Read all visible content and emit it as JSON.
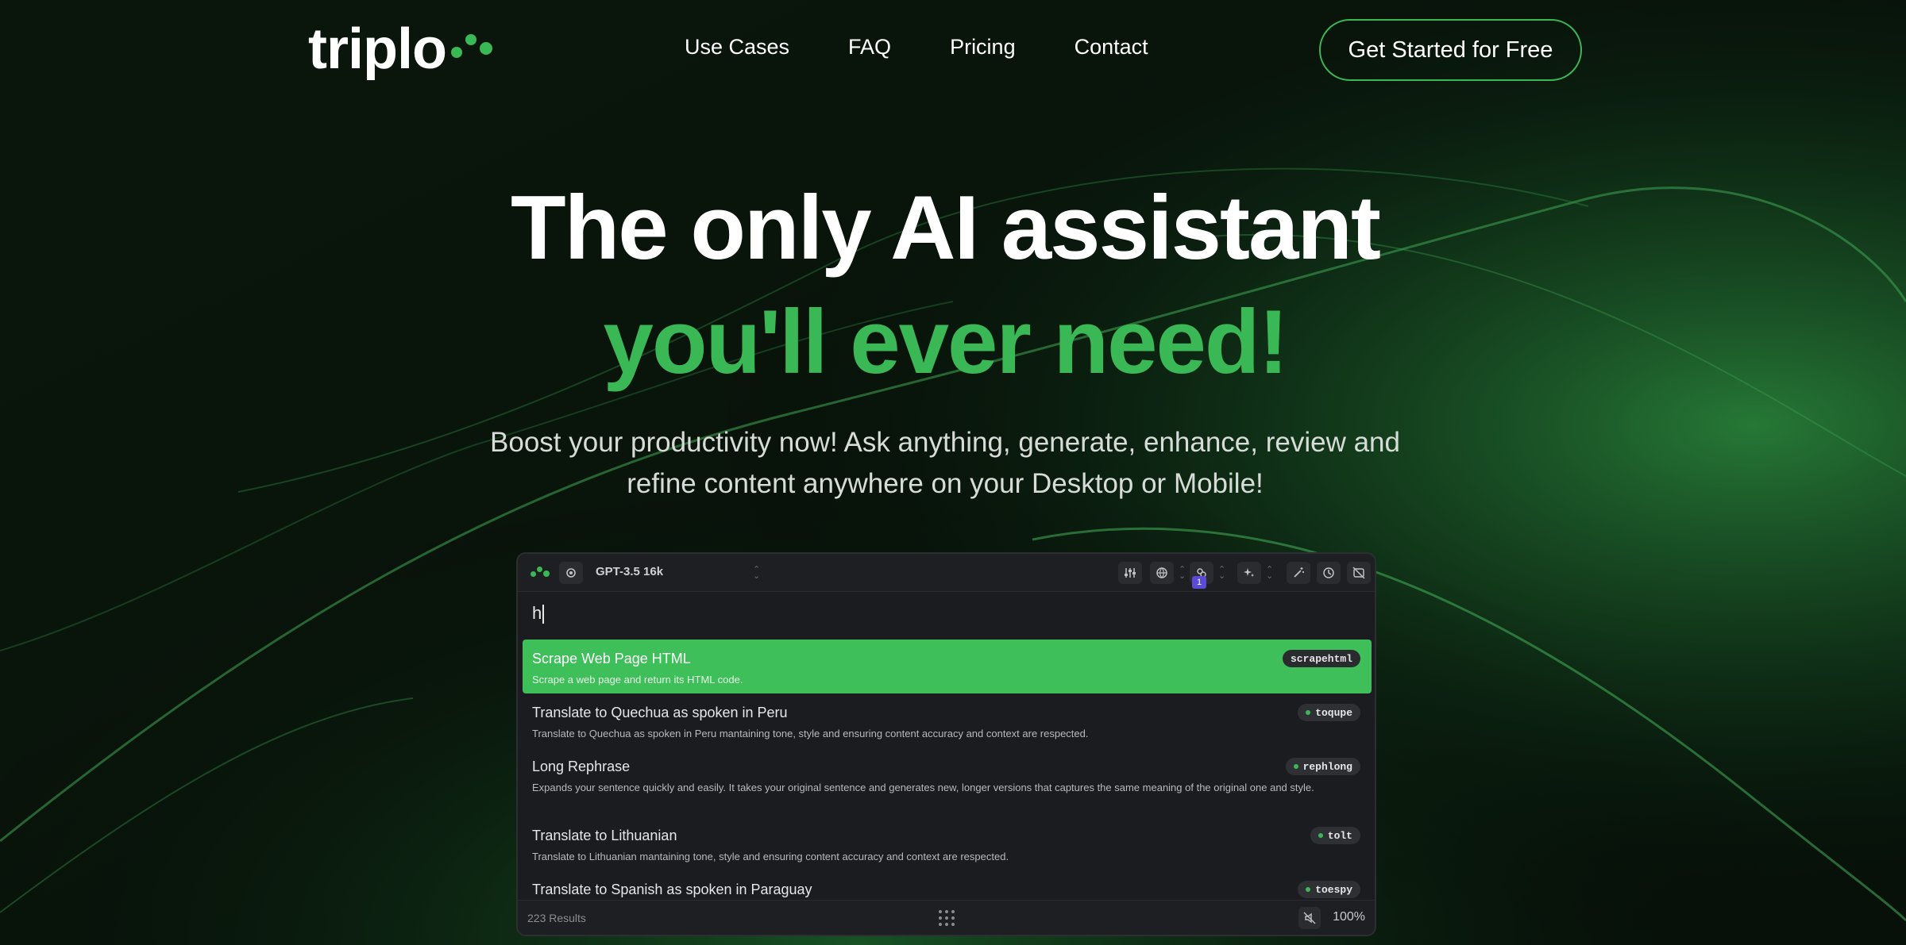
{
  "brand": {
    "name": "triplo",
    "accent": "#3bb856"
  },
  "nav": {
    "items": [
      "Use Cases",
      "FAQ",
      "Pricing",
      "Contact"
    ],
    "cta": "Get Started for Free"
  },
  "hero": {
    "line1": "The only AI assistant",
    "line2": "you'll ever need!",
    "subtitle": "Boost your productivity now! Ask anything, generate, enhance, review and refine content anywhere on your Desktop or Mobile!"
  },
  "app": {
    "model": "GPT-3.5 16k",
    "badge_count": "1",
    "query": "h",
    "results": [
      {
        "title": "Scrape Web Page HTML",
        "desc": "Scrape a web page and return its HTML code.",
        "tag": "scrapehtml",
        "active": true
      },
      {
        "title": "Translate to Quechua as spoken in Peru",
        "desc": "Translate to Quechua as spoken in Peru mantaining tone, style and ensuring content accuracy and context are respected.",
        "tag": "toqupe",
        "active": false
      },
      {
        "title": "Long Rephrase",
        "desc": "Expands your sentence quickly and easily. It takes your original sentence and generates new, longer versions that captures the same meaning of the original one and style.",
        "tag": "rephlong",
        "active": false
      },
      {
        "title": "Translate to Lithuanian",
        "desc": "Translate to Lithuanian mantaining tone, style and ensuring content accuracy and context are respected.",
        "tag": "tolt",
        "active": false
      },
      {
        "title": "Translate to Spanish as spoken in Paraguay",
        "desc": "",
        "tag": "toespy",
        "active": false
      }
    ],
    "results_count": "223 Results",
    "zoom": "100%",
    "icons": [
      "settings-icon",
      "sliders-icon",
      "globe-icon",
      "link-icon",
      "sparkles-icon",
      "wand-icon",
      "history-icon",
      "hide-icon",
      "grip-icon",
      "mute-icon"
    ]
  }
}
